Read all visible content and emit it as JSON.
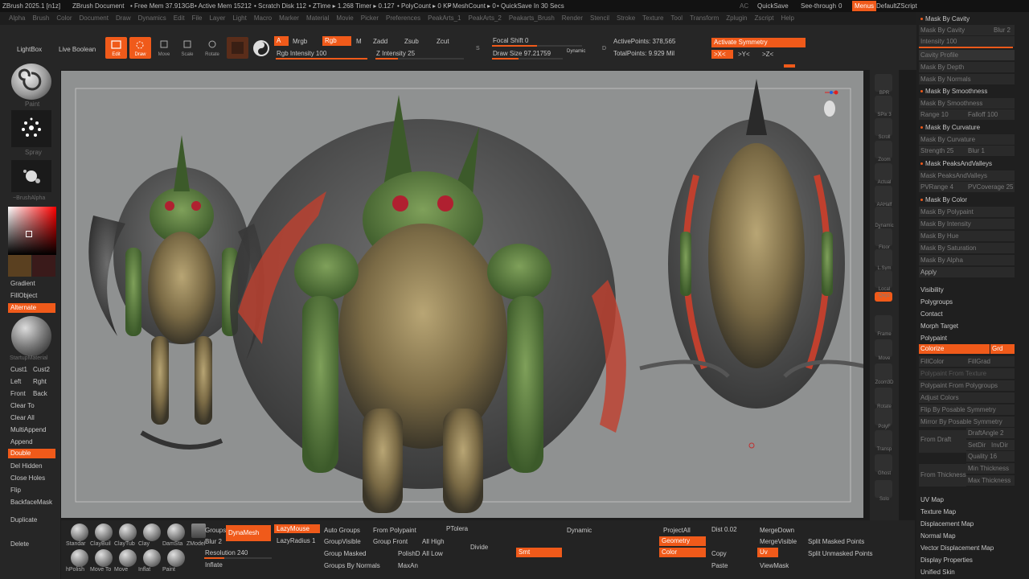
{
  "title_bar": {
    "app": "ZBrush 2025.1 [n1z]",
    "doc": "ZBrush Document",
    "free_mem": "• Free Mem 37.913GB",
    "active_mem": "• Active Mem 15212",
    "scratch": "• Scratch Disk 112",
    "ztime": "• ZTime ▸ 1.268 Timer ▸ 0.127",
    "polycount": "• PolyCount ▸ 0 KP",
    "meshcount": "• MeshCount ▸ 0",
    "quicksave_timer": "• QuickSave In 30 Secs",
    "ac": "AC",
    "quicksave": "QuickSave",
    "see_through": "See-through",
    "see_through_val": "0",
    "menus": "Menus",
    "default_zscript": "DefaultZScript"
  },
  "menu_items": [
    "Alpha",
    "Brush",
    "Color",
    "Document",
    "Draw",
    "Dynamics",
    "Edit",
    "File",
    "Layer",
    "Light",
    "Macro",
    "Marker",
    "Material",
    "Movie",
    "Picker",
    "Preferences",
    "PeakArts_1",
    "PeakArts_2",
    "Peakarts_Brush",
    "Render",
    "Stencil",
    "Stroke",
    "Texture",
    "Tool",
    "Transform",
    "Zplugin",
    "Zscript",
    "Help"
  ],
  "shelf": {
    "lightbox": "LightBox",
    "live_boolean": "Live Boolean",
    "edit": "Edit",
    "draw": "Draw",
    "move": "Move",
    "scale": "Scale",
    "rotate": "Rotate",
    "a": "A",
    "mrgb": "Mrgb",
    "rgb": "Rgb",
    "m": "M",
    "rgb_intensity": "Rgb Intensity 100",
    "zadd": "Zadd",
    "zsub": "Zsub",
    "zcut": "Zcut",
    "z_intensity": "Z Intensity 25",
    "focal_shift": "Focal Shift 0",
    "draw_size": "Draw Size 97.21759",
    "dynamic": "Dynamic",
    "active_points": "ActivePoints: 378,565",
    "total_points": "TotalPoints: 9.929 Mil",
    "activate_symmetry": "Activate Symmetry",
    "sym_x": ">X<",
    "sym_y": ">Y<",
    "sym_z": ">Z<",
    "s_label": "S",
    "d_label": "D"
  },
  "left": {
    "paint": "Paint",
    "spray": "Spray",
    "brush_alpha": "~BrushAlpha",
    "gradient": "Gradient",
    "fill_object": "FillObject",
    "alternate": "Alternate",
    "startup_material": "StartupMaterial",
    "cust1": "Cust1",
    "cust2": "Cust2",
    "left": "Left",
    "right": "Rght",
    "front": "Front",
    "back": "Back",
    "clear_to": "Clear To",
    "clear_all": "Clear All",
    "multi_append": "MultiAppend",
    "append": "Append",
    "double": "Double",
    "del_hidden": "Del Hidden",
    "close_holes": "Close Holes",
    "flip": "Flip",
    "backface_mask": "BackfaceMask",
    "duplicate": "Duplicate",
    "delete": "Delete"
  },
  "right_shelf": [
    "BPR",
    "SPix 3",
    "Scroll",
    "Zoom",
    "Actual",
    "AAHalf",
    "Dynamic Persp",
    "Floor",
    "L.Sym",
    "Local",
    "Qxyz",
    "Frame",
    "Move",
    "Zoom3D",
    "Rotate",
    "PolyF",
    "Transp",
    "Ghost",
    "Solo"
  ],
  "right_panel": {
    "mask_by_cavity_header": "Mask By Cavity",
    "mask_by_cavity": "Mask By Cavity",
    "blur": "Blur 2",
    "intensity": "Intensity 100",
    "cavity_profile": "Cavity Profile",
    "mask_by_depth": "Mask By Depth",
    "mask_by_normals": "Mask By Normals",
    "mask_by_smoothness_header": "Mask By Smoothness",
    "mask_by_smoothness": "Mask By Smoothness",
    "range": "Range 10",
    "falloff": "Falloff 100",
    "mask_by_curvature_header": "Mask By Curvature",
    "mask_by_curvature": "Mask By Curvature",
    "strength": "Strength 25",
    "blur1": "Blur 1",
    "mask_peaks_header": "Mask PeaksAndValleys",
    "mask_peaks": "Mask PeaksAndValleys",
    "pvrange": "PVRange 4",
    "pvcoverage": "PVCoverage 25",
    "mask_by_color_header": "Mask By Color",
    "mask_by_polypaint": "Mask By Polypaint",
    "mask_by_intensity": "Mask By Intensity",
    "mask_by_hue": "Mask By Hue",
    "mask_by_saturation": "Mask By Saturation",
    "mask_by_alpha": "Mask By Alpha",
    "apply": "Apply",
    "visibility": "Visibility",
    "polygroups": "Polygroups",
    "contact": "Contact",
    "morph_target": "Morph Target",
    "polypaint": "Polypaint",
    "colorize": "Colorize",
    "grd": "Grd",
    "fill_color": "FillColor",
    "fill_grad": "FillGrad",
    "polypaint_from_texture": "Polypaint From Texture",
    "polypaint_from_polygroups": "Polypaint From Polygroups",
    "adjust_colors": "Adjust Colors",
    "flip_by_posable": "Flip By Posable Symmetry",
    "mirror_by_posable": "Mirror By Posable Symmetry",
    "from_draft": "From Draft",
    "draft_angle": "DraftAngle 2",
    "set_dir": "SetDir",
    "inv_dir": "InvDir",
    "quality": "Quality 16",
    "from_thickness": "From Thickness",
    "min_thickness": "Min Thickness",
    "max_thickness": "Max Thickness",
    "uv_map": "UV Map",
    "texture_map": "Texture Map",
    "displacement_map": "Displacement Map",
    "normal_map": "Normal Map",
    "vector_displacement_map": "Vector Displacement Map",
    "display_properties": "Display Properties",
    "unified_skin": "Unified Skin"
  },
  "bottom": {
    "brushes": [
      "Standar",
      "ClayBuil",
      "ClayTub",
      "Clay",
      "DamSta",
      "ZModel",
      "hPolish",
      "Move To",
      "Move",
      "Inflat",
      "Paint"
    ],
    "groups": "Groups",
    "dynamesh": "DynaMesh",
    "blur": "Blur 2",
    "resolution": "Resolution 240",
    "inflate": "Inflate",
    "lazy_mouse": "LazyMouse",
    "lazy_radius": "LazyRadius 1",
    "auto_groups": "Auto Groups",
    "group_visible": "GroupVisible",
    "group_masked": "Group Masked",
    "groups_by_normals": "Groups By Normals",
    "from_polypaint": "From Polypaint",
    "group_front": "Group Front",
    "polish_d": "PolishD",
    "max_angle": "MaxAn",
    "p_tolerance": "PTolera",
    "all_high": "All High",
    "all_low": "All Low",
    "divide": "Divide",
    "smt": "Smt",
    "dynamic": "Dynamic",
    "project_all": "ProjectAll",
    "geometry": "Geometry",
    "color": "Color",
    "dist": "Dist 0.02",
    "copy": "Copy",
    "paste": "Paste",
    "merge_down": "MergeDown",
    "merge_visible": "MergeVisible",
    "uv": "Uv",
    "view_mask": "ViewMask",
    "split_masked": "Split Masked Points",
    "split_unmasked": "Split Unmasked Points"
  },
  "colors": {
    "accent": "#f05a1a",
    "canvas": "#8f9191"
  }
}
